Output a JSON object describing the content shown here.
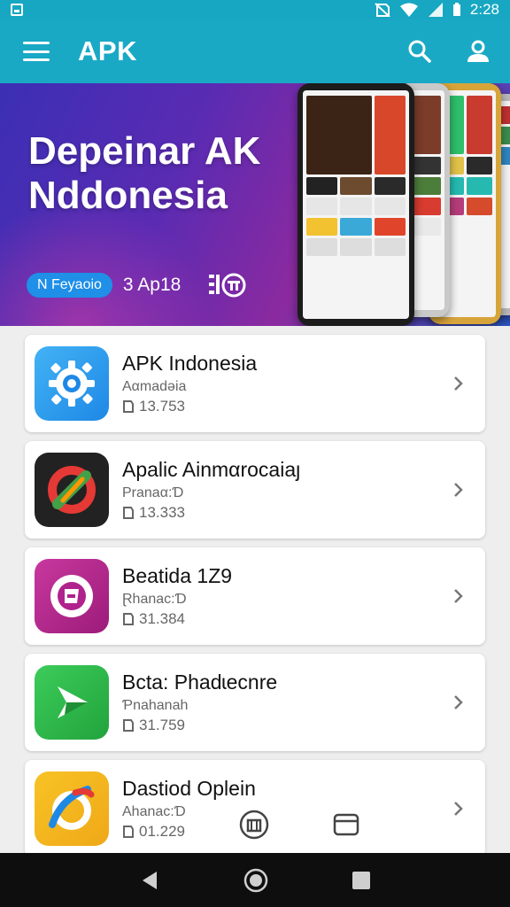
{
  "status_bar": {
    "time": "2:28"
  },
  "app_bar": {
    "title": "APK"
  },
  "hero": {
    "title_line1": "Depeinar AK",
    "title_line2": "Nddonesia",
    "badge": "Ν Feyaoio",
    "date": "3 Ap18"
  },
  "apps": [
    {
      "name": "APK Indonesia",
      "subtitle": "Aαmadəia",
      "meta": "13.753",
      "icon": "gear-icon",
      "color": "#2196f3"
    },
    {
      "name": "Apalic Ainmαrocaiaȷ",
      "subtitle": "Pranaα:Ɗ",
      "meta": "13.333",
      "icon": "colorful-ring-icon",
      "color": "#222222"
    },
    {
      "name": "Beatida 1Z9",
      "subtitle": "Ɽhanac:Ɗ",
      "meta": "31.384",
      "icon": "music-icon",
      "color": "#b0228c"
    },
    {
      "name": "Bcta: Phadɩecnre",
      "subtitle": "Ƥnahanah",
      "meta": "31.759",
      "icon": "play-icon",
      "color": "#2fb94a"
    },
    {
      "name": "Dastiod Oplein",
      "subtitle": "Ahanac:Ɗ",
      "meta": "01.229",
      "icon": "brush-icon",
      "color": "#f2b21a"
    }
  ]
}
